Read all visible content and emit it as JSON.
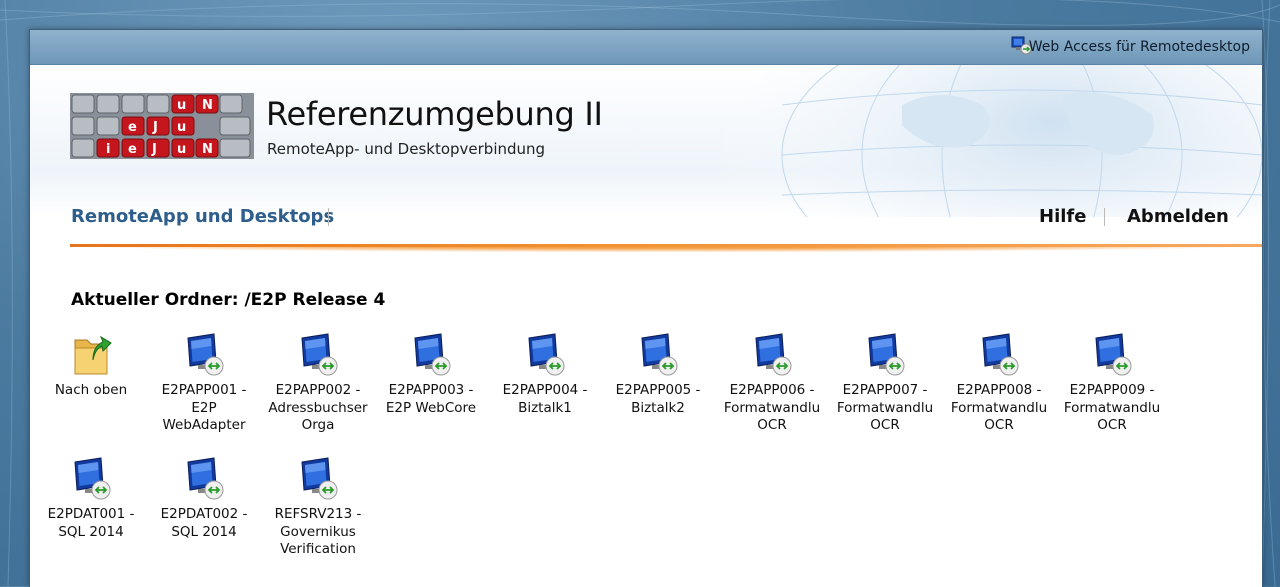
{
  "window_title": "Web Access für Remotedesktop",
  "header": {
    "title": "Referenzumgebung II",
    "subtitle": "RemoteApp- und Desktopverbindung"
  },
  "nav": {
    "main": "RemoteApp und Desktops",
    "help": "Hilfe",
    "logout": "Abmelden"
  },
  "folder": {
    "title": "Aktueller Ordner: /E2P Release 4"
  },
  "items": [
    {
      "label": "Nach oben",
      "icon": "folder-up-icon"
    },
    {
      "label": "E2PAPP001 -\nE2P\nWebAdapter",
      "icon": "remote-desktop-icon"
    },
    {
      "label": "E2PAPP002 -\nAdressbuchser\nOrga",
      "icon": "remote-desktop-icon"
    },
    {
      "label": "E2PAPP003 -\nE2P WebCore",
      "icon": "remote-desktop-icon"
    },
    {
      "label": "E2PAPP004 -\nBiztalk1",
      "icon": "remote-desktop-icon"
    },
    {
      "label": "E2PAPP005 -\nBiztalk2",
      "icon": "remote-desktop-icon"
    },
    {
      "label": "E2PAPP006 -\nFormatwandlu\nOCR",
      "icon": "remote-desktop-icon"
    },
    {
      "label": "E2PAPP007 -\nFormatwandlu\nOCR",
      "icon": "remote-desktop-icon"
    },
    {
      "label": "E2PAPP008 -\nFormatwandlu\nOCR",
      "icon": "remote-desktop-icon"
    },
    {
      "label": "E2PAPP009 -\nFormatwandlu\nOCR",
      "icon": "remote-desktop-icon"
    },
    {
      "label": "E2PDAT001 -\nSQL 2014",
      "icon": "remote-desktop-icon"
    },
    {
      "label": "E2PDAT002 -\nSQL 2014",
      "icon": "remote-desktop-icon"
    },
    {
      "label": "REFSRV213 -\nGovernikus\nVerification",
      "icon": "remote-desktop-icon"
    }
  ]
}
